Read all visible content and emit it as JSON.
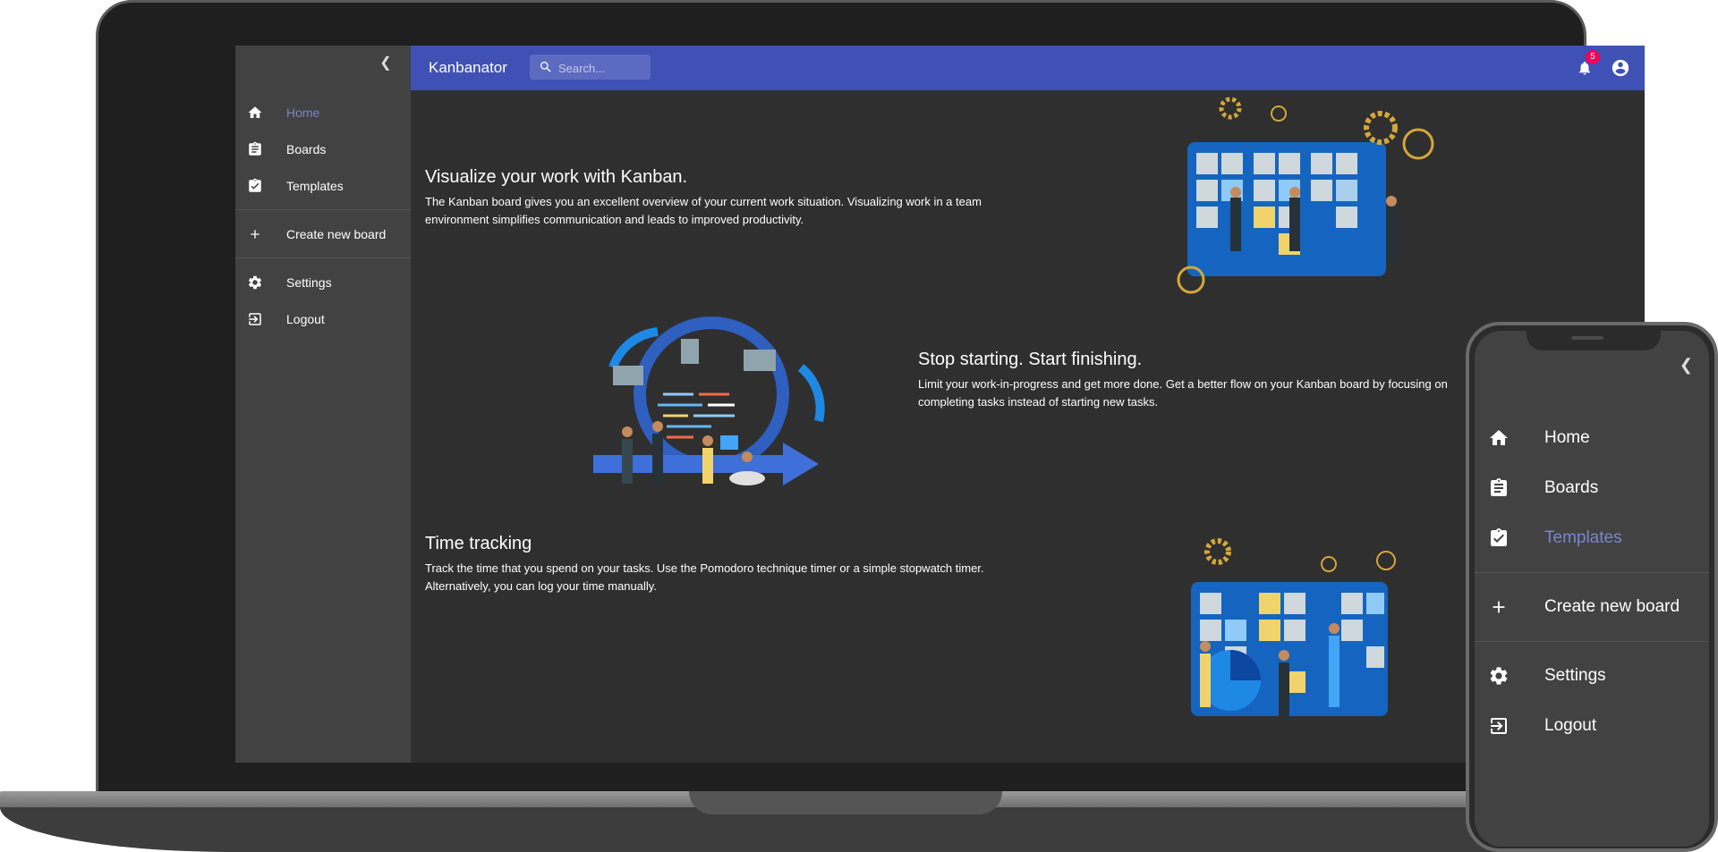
{
  "app": {
    "title": "Kanbanator"
  },
  "search": {
    "placeholder": "Search..."
  },
  "notifications": {
    "count": "5"
  },
  "sidebar": {
    "items": [
      {
        "label": "Home",
        "icon": "home-icon"
      },
      {
        "label": "Boards",
        "icon": "clipboard-icon"
      },
      {
        "label": "Templates",
        "icon": "clipboard-check-icon"
      },
      {
        "label": "Create new board",
        "icon": "plus-icon"
      },
      {
        "label": "Settings",
        "icon": "gear-icon"
      },
      {
        "label": "Logout",
        "icon": "logout-icon"
      }
    ],
    "active": "Home"
  },
  "sections": [
    {
      "title": "Visualize your work with Kanban.",
      "text": "The Kanban board gives you an excellent overview of your current work situation. Visualizing work in a team environment simplifies communication and leads to improved productivity."
    },
    {
      "title": "Stop starting. Start finishing.",
      "text": "Limit your work-in-progress and get more done. Get a better flow on your Kanban board by focusing on completing tasks instead of starting new tasks."
    },
    {
      "title": "Time tracking",
      "text": "Track the time that you spend on your tasks. Use the Pomodoro technique timer or a simple stopwatch timer. Alternatively, you can log your time manually."
    }
  ],
  "phone_nav": {
    "items": [
      {
        "label": "Home",
        "icon": "home-icon"
      },
      {
        "label": "Boards",
        "icon": "clipboard-icon"
      },
      {
        "label": "Templates",
        "icon": "clipboard-check-icon"
      },
      {
        "label": "Create new board",
        "icon": "plus-icon"
      },
      {
        "label": "Settings",
        "icon": "gear-icon"
      },
      {
        "label": "Logout",
        "icon": "logout-icon"
      }
    ],
    "active": "Templates"
  },
  "colors": {
    "primary": "#3f51b5",
    "accent": "#7986cb",
    "badge": "#f50057",
    "sidebar": "#424242",
    "content": "#2f2f2f"
  }
}
